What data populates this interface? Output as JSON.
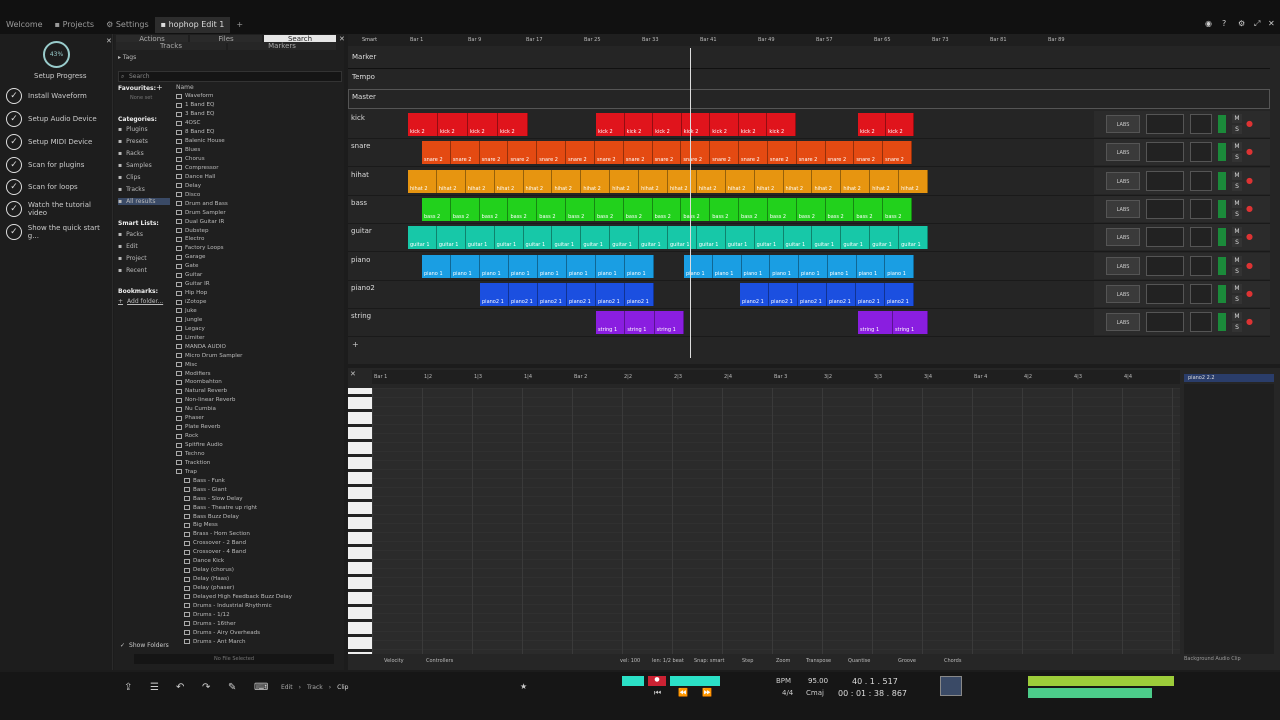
{
  "tabs": [
    "Welcome",
    "Projects",
    "Settings",
    "hophop Edit 1",
    "+"
  ],
  "setup": {
    "progress": "43%",
    "title": "Setup Progress",
    "items": [
      "Install Waveform",
      "Setup Audio Device",
      "Setup MIDI Device",
      "Scan for plugins",
      "Scan for loops",
      "Watch the tutorial video",
      "Show the quick start g..."
    ]
  },
  "browser": {
    "tabs_top": [
      "Actions",
      "Files",
      "Search"
    ],
    "tabs_bottom": [
      "Tracks",
      "Markers"
    ],
    "tags": "Tags",
    "search_placeholder": "Search",
    "favourites": "Favourites:",
    "none_set": "None set",
    "categories_label": "Categories:",
    "categories": [
      "Plugins",
      "Presets",
      "Racks",
      "Samples",
      "Clips",
      "Tracks",
      "All results"
    ],
    "smart_lists_label": "Smart Lists:",
    "smart_lists": [
      "Packs",
      "Edit",
      "Project",
      "Recent"
    ],
    "bookmarks_label": "Bookmarks:",
    "add_folder": "Add folder...",
    "name_header": "Name",
    "items": [
      "Waveform",
      "1 Band EQ",
      "3 Band EQ",
      "4OSC",
      "8 Band EQ",
      "Balenic House",
      "Blues",
      "Chorus",
      "Compressor",
      "Dance Hall",
      "Delay",
      "Disco",
      "Drum and Bass",
      "Drum Sampler",
      "Dual Guitar IR",
      "Dubstep",
      "Electro",
      "Factory Loops",
      "Garage",
      "Gate",
      "Guitar",
      "Guitar IR",
      "Hip Hop",
      "iZotope",
      "Juke",
      "Jungle",
      "Legacy",
      "Limiter",
      "MANDA AUDIO",
      "Micro Drum Sampler",
      "Misc",
      "Modifiers",
      "Moombahton",
      "Natural Reverb",
      "Non-linear Reverb",
      "Nu Cumbia",
      "Phaser",
      "Plate Reverb",
      "Rock",
      "Spitfire Audio",
      "Techno",
      "Tracktion",
      "Trap",
      "Bass - Funk",
      "Bass - Giant",
      "Bass - Slow Delay",
      "Bass - Theatre up right",
      "Bass Buzz Delay",
      "Big Mess",
      "Brass - Horn Section",
      "Crossover - 2 Band",
      "Crossover - 4 Band",
      "Dance Kick",
      "Delay (chorus)",
      "Delay (Haas)",
      "Delay (phaser)",
      "Delayed High Feedback Buzz Delay",
      "Drums - Industrial Rhythmic",
      "Drums - 1/12",
      "Drums - 16ther",
      "Drums - Airy Overheads",
      "Drums - Ant March"
    ],
    "show_folders": "Show Folders",
    "no_file": "No File Selected"
  },
  "arranger": {
    "smart": "Smart",
    "ruler": [
      "Bar 1",
      "Bar 9",
      "Bar 17",
      "Bar 25",
      "Bar 33",
      "Bar 41",
      "Bar 49",
      "Bar 57",
      "Bar 65",
      "Bar 73",
      "Bar 81",
      "Bar 89"
    ],
    "global_tracks": [
      "Marker",
      "Tempo",
      "Master"
    ],
    "labs": "LABS",
    "tracks": [
      {
        "name": "kick",
        "color": "#e0141c",
        "clip": "kick 2"
      },
      {
        "name": "snare",
        "color": "#e44a12",
        "clip": "snare 2"
      },
      {
        "name": "hihat",
        "color": "#e79510",
        "clip": "hihat 2"
      },
      {
        "name": "bass",
        "color": "#22d11c",
        "clip": "bass 2"
      },
      {
        "name": "guitar",
        "color": "#17c8a8",
        "clip": "guitar 1"
      },
      {
        "name": "piano",
        "color": "#1a9ee3",
        "clip": "piano 1"
      },
      {
        "name": "piano2",
        "color": "#1b4fe0",
        "clip": "piano2 1"
      },
      {
        "name": "string",
        "color": "#8a1ee0",
        "clip": "string 1"
      }
    ]
  },
  "editor": {
    "ruler": [
      "Bar 1",
      "1|2",
      "1|3",
      "1|4",
      "Bar 2",
      "2|2",
      "2|3",
      "2|4",
      "Bar 3",
      "3|2",
      "3|3",
      "3|4",
      "Bar 4",
      "4|2",
      "4|3",
      "4|4"
    ],
    "clip_name": "piano2 2.2",
    "toolbar": [
      "Velocity",
      "Controllers",
      "vel: 100",
      "len: 1/2 beat",
      "Snap: smart",
      "Step",
      "Zoom",
      "Transpose",
      "Quantise",
      "Groove",
      "Chords"
    ],
    "bg_clip": "Background Audio Clip"
  },
  "transport": {
    "breadcrumb": [
      "Edit",
      "Track",
      "Clip"
    ],
    "bpm_label": "BPM",
    "bpm": "95.00",
    "sig": "4/4",
    "key": "Cmaj",
    "position": "40 . 1 . 517",
    "time": "00 : 01 : 38 . 867"
  }
}
